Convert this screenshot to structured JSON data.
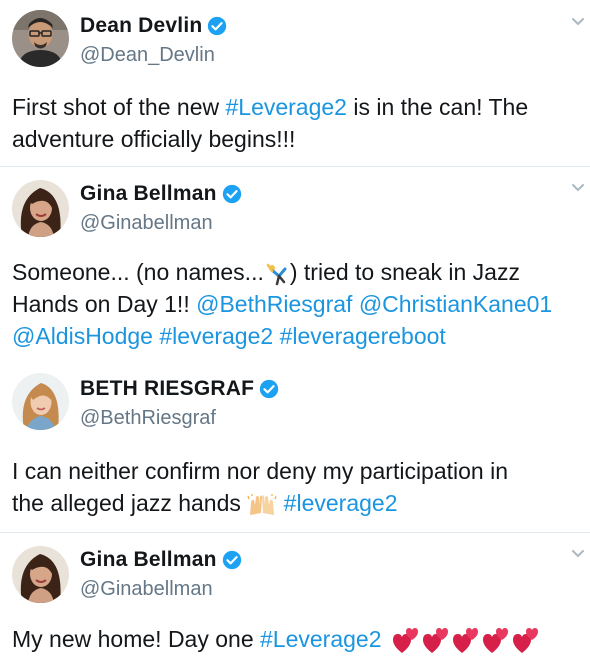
{
  "colors": {
    "link": "#1b95e0",
    "verified": "#1da1f2",
    "handle": "#657786",
    "divider": "#e1e8ed"
  },
  "tweets": [
    {
      "name": "Dean Devlin",
      "handle": "@Dean_Devlin",
      "verified": true,
      "has_menu": true,
      "text": {
        "line1_a": "First shot of the new ",
        "line1_tag": "#Leverage2",
        "line1_b": " is in the can! The",
        "line2": "adventure officially begins!!!"
      }
    },
    {
      "name": "Gina Bellman",
      "handle": "@Ginabellman",
      "verified": true,
      "has_menu": true,
      "text": {
        "line1_a": "Someone... (no names...",
        "line1_emoji": "person-cartwheeling",
        "line1_b": ") tried to sneak in Jazz",
        "line2_a": "Hands on Day 1!!  ",
        "line2_m1": "@BethRiesgraf",
        "line2_sp": " ",
        "line2_m2": "@ChristianKane01",
        "line3_m3": "@AldisHodge",
        "line3_sp1": " ",
        "line3_t1": "#leverage2",
        "line3_sp2": " ",
        "line3_t2": "#leveragereboot"
      }
    },
    {
      "name": "BETH RIESGRAF",
      "handle": "@BethRiesgraf",
      "verified": true,
      "has_menu": false,
      "text": {
        "line1": "I can neither confirm nor deny my participation in",
        "line2_a": "the alleged jazz hands ",
        "line2_emoji": "raising-hands",
        "line2_sp": " ",
        "line2_tag": "#leverage2"
      }
    },
    {
      "name": "Gina Bellman",
      "handle": "@Ginabellman",
      "verified": true,
      "has_menu": true,
      "text": {
        "line1_a": "My new home! Day one ",
        "line1_tag": "#Leverage2",
        "line1_emoji": "two-hearts x5"
      }
    }
  ]
}
